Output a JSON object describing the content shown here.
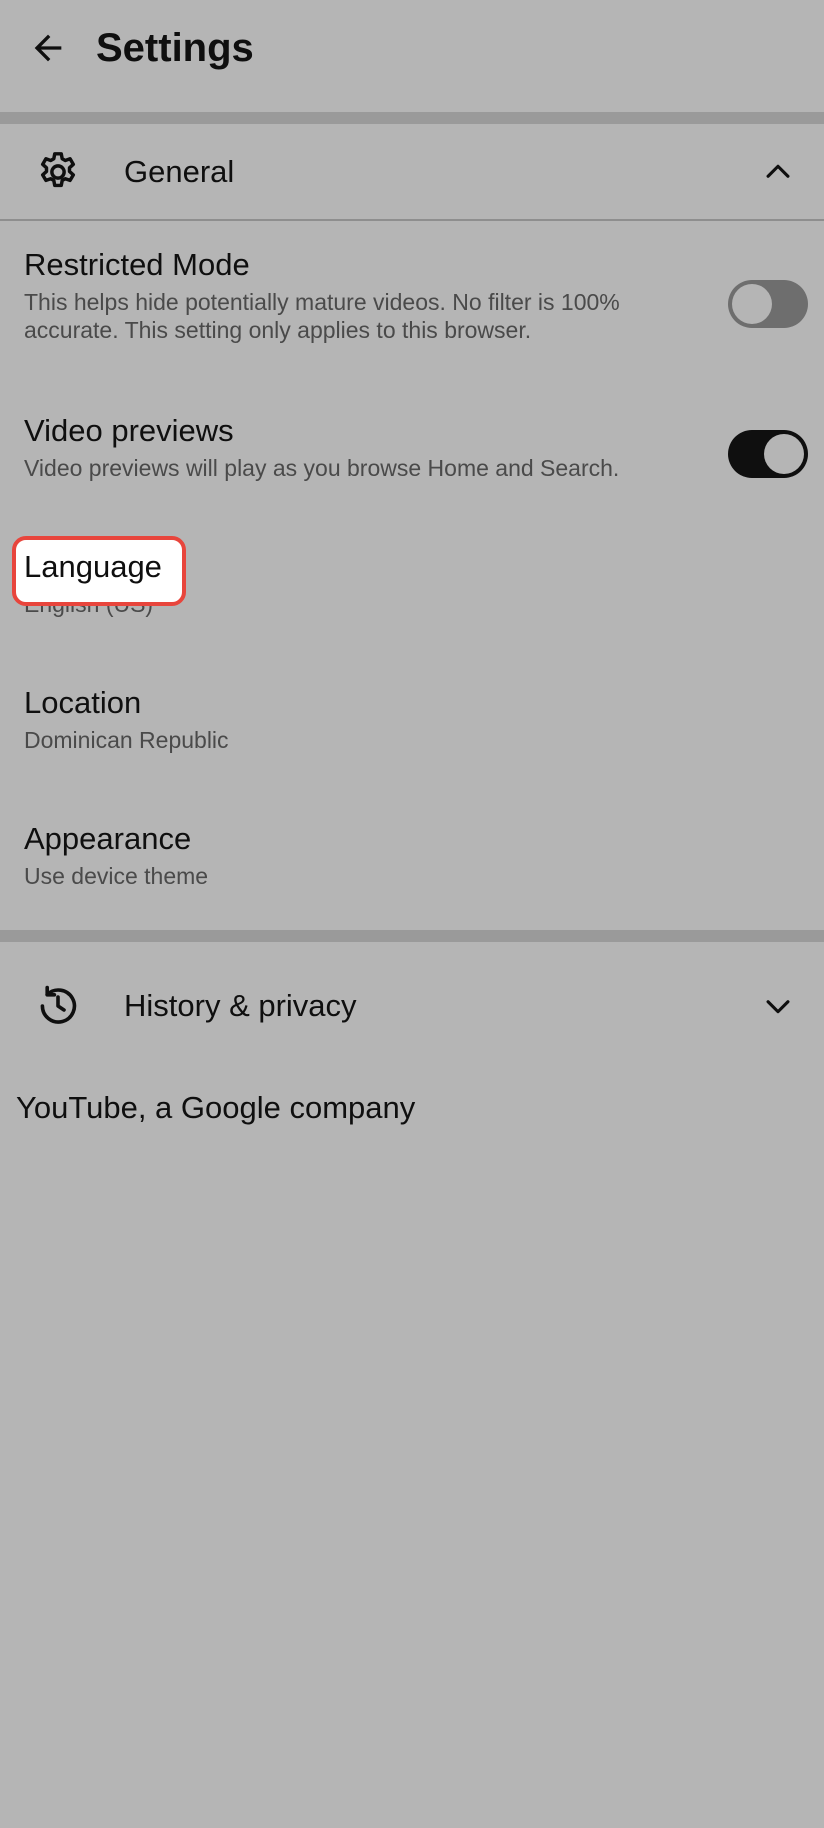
{
  "header": {
    "title": "Settings",
    "back_icon": "arrow-back-icon"
  },
  "general": {
    "label": "General",
    "icon": "gear-icon",
    "expanded": true,
    "items": [
      {
        "title": "Restricted Mode",
        "subtitle": "This helps hide potentially mature videos. No filter is 100% accurate. This setting only applies to this browser.",
        "toggle": false
      },
      {
        "title": "Video previews",
        "subtitle": "Video previews will play as you browse Home and Search.",
        "toggle": true
      },
      {
        "title": "Language",
        "subtitle": "English (US)"
      },
      {
        "title": "Location",
        "subtitle": "Dominican Republic"
      },
      {
        "title": "Appearance",
        "subtitle": "Use device theme"
      }
    ]
  },
  "history": {
    "label": "History & privacy",
    "icon": "history-icon",
    "expanded": false
  },
  "footer": {
    "text": "YouTube, a Google company"
  },
  "colors": {
    "background": "#b5b5b5",
    "highlight_border": "#e8453c",
    "toggle_on": "#0f0f0f",
    "toggle_off": "#6e6e6e"
  }
}
